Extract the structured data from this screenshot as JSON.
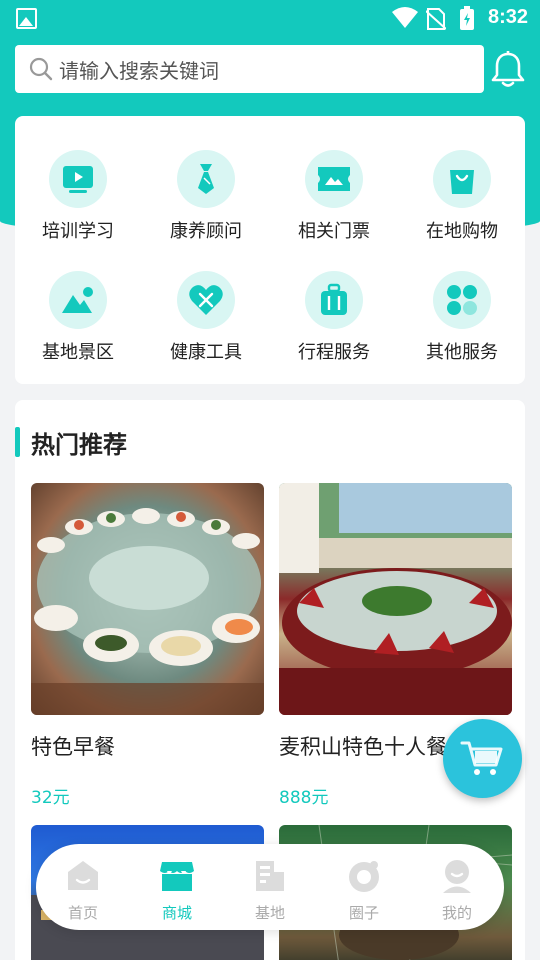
{
  "status_bar": {
    "time": "8:32"
  },
  "search": {
    "placeholder": "请输入搜索关键词"
  },
  "categories": [
    {
      "label": "培训学习",
      "icon": "video-icon"
    },
    {
      "label": "康养顾问",
      "icon": "tie-icon"
    },
    {
      "label": "相关门票",
      "icon": "ticket-icon"
    },
    {
      "label": "在地购物",
      "icon": "shopping-bag-icon"
    },
    {
      "label": "基地景区",
      "icon": "mountain-icon"
    },
    {
      "label": "健康工具",
      "icon": "heart-tools-icon"
    },
    {
      "label": "行程服务",
      "icon": "luggage-icon"
    },
    {
      "label": "其他服务",
      "icon": "dots-grid-icon"
    }
  ],
  "hot": {
    "title": "热门推荐",
    "products": [
      {
        "name": "特色早餐",
        "price": "32元"
      },
      {
        "name": "麦积山特色十人餐",
        "price": "888元"
      }
    ]
  },
  "tabs": [
    {
      "label": "首页",
      "icon": "home-icon",
      "active": false
    },
    {
      "label": "商城",
      "icon": "store-icon",
      "active": true
    },
    {
      "label": "基地",
      "icon": "building-icon",
      "active": false
    },
    {
      "label": "圈子",
      "icon": "circle-icon",
      "active": false
    },
    {
      "label": "我的",
      "icon": "user-icon",
      "active": false
    }
  ],
  "colors": {
    "accent": "#13c9bd",
    "icon_bg": "#d9f6f3",
    "cart": "#2bc3dc"
  }
}
